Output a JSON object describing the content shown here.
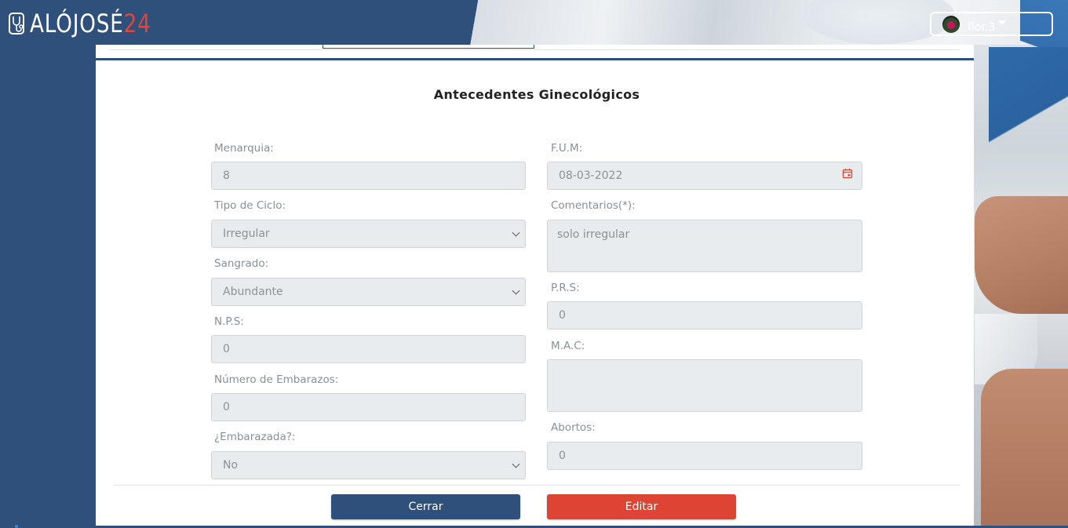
{
  "brand": {
    "logo_text_main": "ALÓJOSÉ",
    "logo_text_num": "24",
    "accent": "#e0463a",
    "primary": "#2e507a"
  },
  "user": {
    "name": "flor.3",
    "avatar_icon": "user-avatar"
  },
  "section": {
    "title": "Antecedentes Ginecológicos"
  },
  "form": {
    "menarquia": {
      "label": "Menarquia:",
      "value": "8"
    },
    "fum": {
      "label": "F.U.M:",
      "value": "08-03-2022",
      "icon": "calendar-icon"
    },
    "tipo_ciclo": {
      "label": "Tipo de Ciclo:",
      "value": "Irregular"
    },
    "comentarios": {
      "label": "Comentarios(*):",
      "value": "solo irregular"
    },
    "sangrado": {
      "label": "Sangrado:",
      "value": "Abundante"
    },
    "prs": {
      "label": "P.R.S:",
      "value": "0"
    },
    "nps": {
      "label": "N.P.S:",
      "value": "0"
    },
    "mac": {
      "label": "M.A.C:",
      "value": ""
    },
    "num_embarazos": {
      "label": "Número de Embarazos:",
      "value": "0"
    },
    "abortos": {
      "label": "Abortos:",
      "value": "0"
    },
    "embarazada": {
      "label": "¿Embarazada?:",
      "value": "No"
    }
  },
  "actions": {
    "close_label": "Cerrar",
    "edit_label": "Editar",
    "edit_color": "#dd4433"
  }
}
